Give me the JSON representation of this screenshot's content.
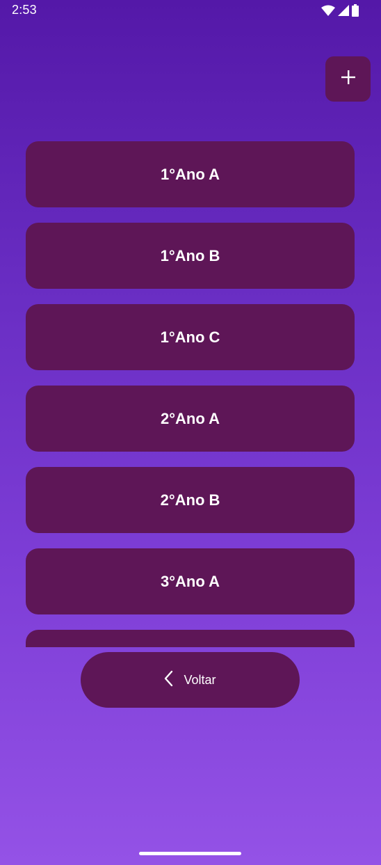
{
  "status_bar": {
    "time": "2:53",
    "icons": [
      "wifi-icon",
      "cell-signal-icon",
      "battery-icon"
    ]
  },
  "toolbar": {
    "add_icon": "plus-icon"
  },
  "class_list": {
    "items": [
      {
        "label": "1°Ano A"
      },
      {
        "label": "1°Ano B"
      },
      {
        "label": "1°Ano C"
      },
      {
        "label": "2°Ano A"
      },
      {
        "label": "2°Ano B"
      },
      {
        "label": "3°Ano A"
      },
      {
        "label": ""
      }
    ]
  },
  "back_button": {
    "label": "Voltar",
    "icon": "chevron-left-icon"
  },
  "colors": {
    "background_top": "#5418a8",
    "background_bottom": "#9452e6",
    "button": "#5e1657",
    "text": "#ffffff"
  }
}
